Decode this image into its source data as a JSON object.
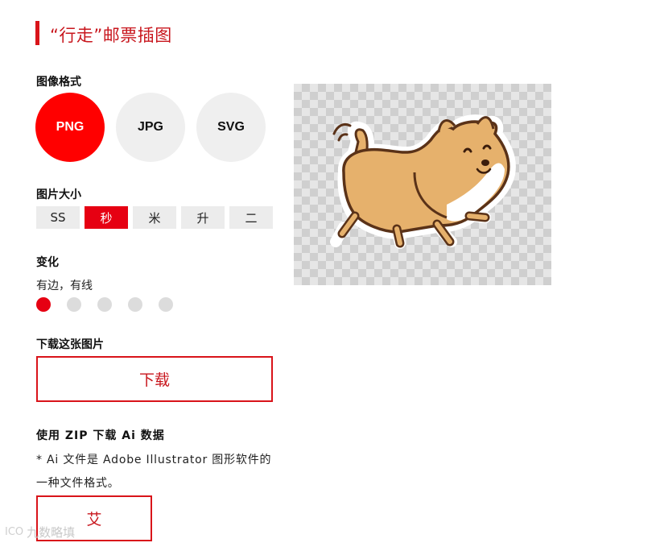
{
  "header": {
    "title": "“行走”邮票插图"
  },
  "format": {
    "label": "图像格式",
    "options": [
      "PNG",
      "JPG",
      "SVG"
    ],
    "selected": "PNG"
  },
  "size": {
    "label": "图片大小",
    "options": [
      "SS",
      "秒",
      "米",
      "升",
      "二"
    ],
    "selected": "秒"
  },
  "variant": {
    "label": "变化",
    "current": "有边，有线",
    "count": 5,
    "selected_index": 0
  },
  "download": {
    "label": "下载这张图片",
    "button_label": "下载"
  },
  "zip": {
    "label": "使用 ZIP 下载 Ai 数据",
    "note": "* Ai 文件是 Adobe Illustrator 图形软件的一种文件格式。",
    "button_label": "艾"
  },
  "watermark": {
    "logo": "ICO",
    "text": "九数略填"
  },
  "colors": {
    "accent": "#e60012",
    "title": "#c8161d",
    "inactive": "#efefef"
  },
  "preview": {
    "icon": "running-shiba-dog-illustration"
  }
}
